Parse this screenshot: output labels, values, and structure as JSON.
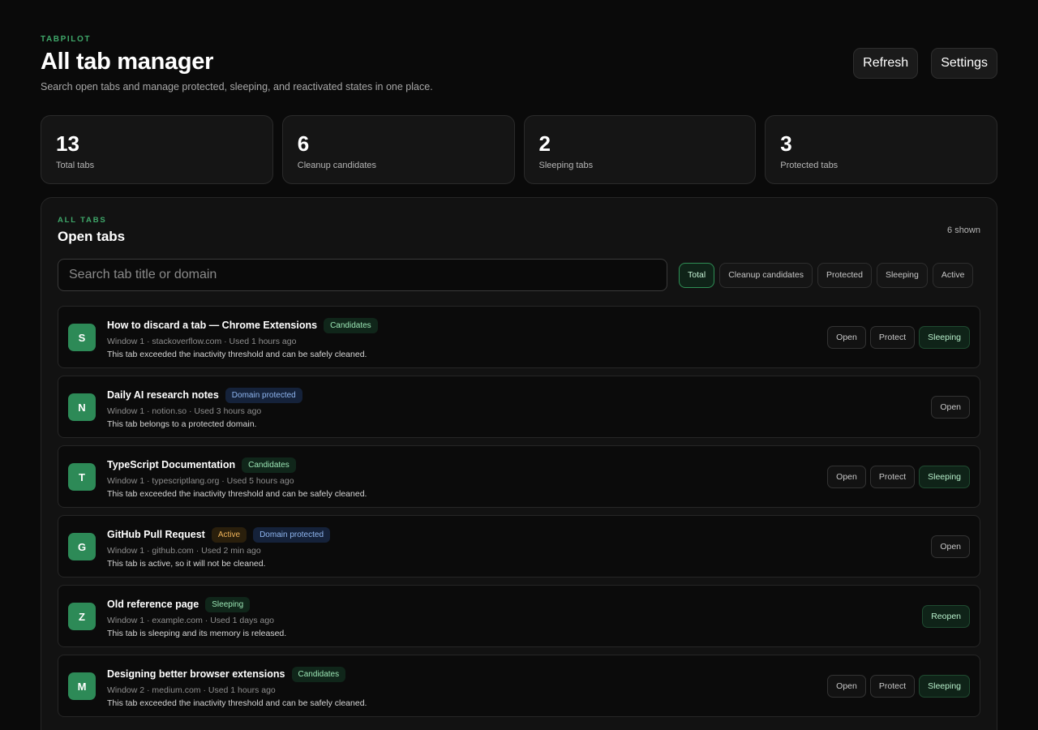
{
  "header": {
    "eyebrow": "TABPILOT",
    "title": "All tab manager",
    "subtitle": "Search open tabs and manage protected, sleeping, and reactivated states in one place.",
    "refresh_label": "Refresh",
    "settings_label": "Settings"
  },
  "stats": [
    {
      "value": "13",
      "label": "Total tabs"
    },
    {
      "value": "6",
      "label": "Cleanup candidates"
    },
    {
      "value": "2",
      "label": "Sleeping tabs"
    },
    {
      "value": "3",
      "label": "Protected tabs"
    }
  ],
  "panel": {
    "eyebrow": "ALL TABS",
    "title": "Open tabs",
    "shown": "6 shown",
    "search_placeholder": "Search tab title or domain",
    "filters": [
      {
        "label": "Total",
        "active": true
      },
      {
        "label": "Cleanup candidates",
        "active": false
      },
      {
        "label": "Protected",
        "active": false
      },
      {
        "label": "Sleeping",
        "active": false
      },
      {
        "label": "Active",
        "active": false
      }
    ]
  },
  "tabs": [
    {
      "initial": "S",
      "title": "How to discard a tab — Chrome Extensions",
      "badges": [
        {
          "label": "Candidates",
          "style": "green"
        }
      ],
      "meta": "Window 1 · stackoverflow.com · Used 1 hours ago",
      "desc": "This tab exceeded the inactivity threshold and can be safely cleaned.",
      "actions": [
        {
          "label": "Open",
          "style": "default"
        },
        {
          "label": "Protect",
          "style": "default"
        },
        {
          "label": "Sleeping",
          "style": "green"
        }
      ]
    },
    {
      "initial": "N",
      "title": "Daily AI research notes",
      "badges": [
        {
          "label": "Domain protected",
          "style": "blue"
        }
      ],
      "meta": "Window 1 · notion.so · Used 3 hours ago",
      "desc": "This tab belongs to a protected domain.",
      "actions": [
        {
          "label": "Open",
          "style": "default"
        }
      ]
    },
    {
      "initial": "T",
      "title": "TypeScript Documentation",
      "badges": [
        {
          "label": "Candidates",
          "style": "green"
        }
      ],
      "meta": "Window 1 · typescriptlang.org · Used 5 hours ago",
      "desc": "This tab exceeded the inactivity threshold and can be safely cleaned.",
      "actions": [
        {
          "label": "Open",
          "style": "default"
        },
        {
          "label": "Protect",
          "style": "default"
        },
        {
          "label": "Sleeping",
          "style": "green"
        }
      ]
    },
    {
      "initial": "G",
      "title": "GitHub Pull Request",
      "badges": [
        {
          "label": "Active",
          "style": "amber"
        },
        {
          "label": "Domain protected",
          "style": "blue"
        }
      ],
      "meta": "Window 1 · github.com · Used 2 min ago",
      "desc": "This tab is active, so it will not be cleaned.",
      "actions": [
        {
          "label": "Open",
          "style": "default"
        }
      ]
    },
    {
      "initial": "Z",
      "title": "Old reference page",
      "badges": [
        {
          "label": "Sleeping",
          "style": "green"
        }
      ],
      "meta": "Window 1 · example.com · Used 1 days ago",
      "desc": "This tab is sleeping and its memory is released.",
      "actions": [
        {
          "label": "Reopen",
          "style": "green"
        }
      ]
    },
    {
      "initial": "M",
      "title": "Designing better browser extensions",
      "badges": [
        {
          "label": "Candidates",
          "style": "green"
        }
      ],
      "meta": "Window 2 · medium.com · Used 1 hours ago",
      "desc": "This tab exceeded the inactivity threshold and can be safely cleaned.",
      "actions": [
        {
          "label": "Open",
          "style": "default"
        },
        {
          "label": "Protect",
          "style": "default"
        },
        {
          "label": "Sleeping",
          "style": "green"
        }
      ]
    }
  ]
}
